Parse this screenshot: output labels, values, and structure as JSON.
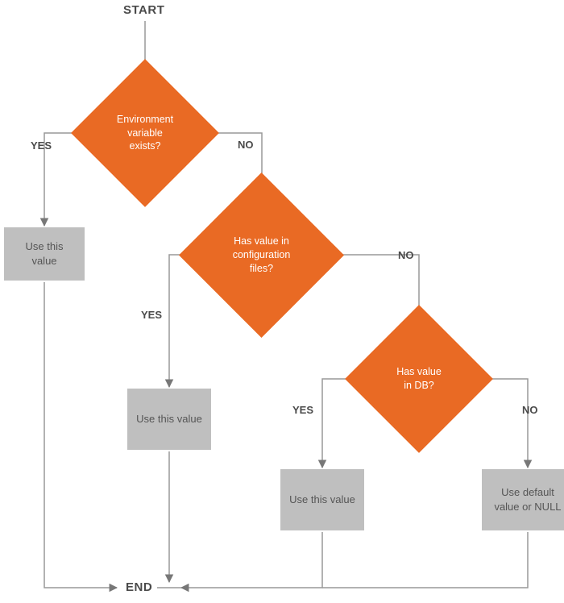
{
  "chart_data": {
    "type": "flowchart",
    "nodes": [
      {
        "id": "start",
        "kind": "terminator",
        "label": "START"
      },
      {
        "id": "d1",
        "kind": "decision",
        "label": "Environment variable exists?"
      },
      {
        "id": "p1",
        "kind": "process",
        "label": "Use this value"
      },
      {
        "id": "d2",
        "kind": "decision",
        "label": "Has value in configuration files?"
      },
      {
        "id": "p2",
        "kind": "process",
        "label": "Use this value"
      },
      {
        "id": "d3",
        "kind": "decision",
        "label": "Has value in DB?"
      },
      {
        "id": "p3",
        "kind": "process",
        "label": "Use this value"
      },
      {
        "id": "p4",
        "kind": "process",
        "label": "Use default value or NULL"
      },
      {
        "id": "end",
        "kind": "terminator",
        "label": "END"
      }
    ],
    "edges": [
      {
        "from": "start",
        "to": "d1",
        "label": ""
      },
      {
        "from": "d1",
        "to": "p1",
        "label": "YES"
      },
      {
        "from": "d1",
        "to": "d2",
        "label": "NO"
      },
      {
        "from": "d2",
        "to": "p2",
        "label": "YES"
      },
      {
        "from": "d2",
        "to": "d3",
        "label": "NO"
      },
      {
        "from": "d3",
        "to": "p3",
        "label": "YES"
      },
      {
        "from": "d3",
        "to": "p4",
        "label": "NO"
      },
      {
        "from": "p1",
        "to": "end",
        "label": ""
      },
      {
        "from": "p2",
        "to": "end",
        "label": ""
      },
      {
        "from": "p3",
        "to": "end",
        "label": ""
      },
      {
        "from": "p4",
        "to": "end",
        "label": ""
      }
    ]
  },
  "labels": {
    "start": "START",
    "end": "END",
    "yes": "YES",
    "no": "NO",
    "d1": "Environment\nvariable\nexists?",
    "d2": "Has value in\nconfiguration\nfiles?",
    "d3": "Has value\nin DB?",
    "p1": "Use this value",
    "p2": "Use this value",
    "p3": "Use this value",
    "p4": "Use default\nvalue or NULL"
  }
}
